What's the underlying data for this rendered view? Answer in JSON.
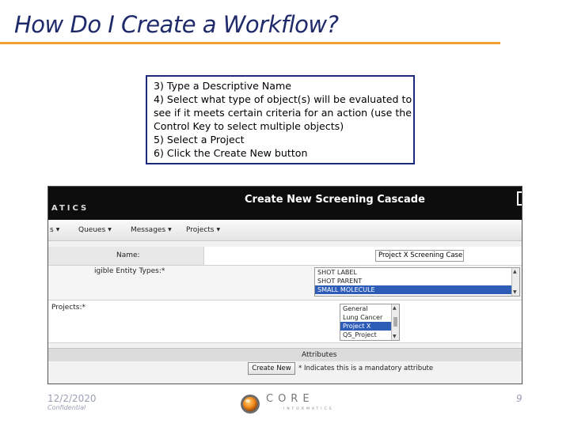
{
  "slide": {
    "title": "How Do I Create a Workflow?",
    "instructions": [
      "3) Type a Descriptive Name",
      "4) Select what type of object(s) will be evaluated to",
      "see if it meets certain criteria for an action (use the",
      "Control Key to select multiple objects)",
      "5) Select a Project",
      "6) Click the Create New button"
    ],
    "footer": {
      "date": "12/2/2020",
      "confidential": "Confidential",
      "page": "9"
    },
    "logo": {
      "word": "CORE",
      "sub": "INFORMATICS"
    }
  },
  "app": {
    "brand": "ATICS",
    "page_heading": "Create New Screening Cascade",
    "nav": [
      "s",
      "Queues",
      "Messages",
      "Projects"
    ],
    "form": {
      "name_label": "Name:",
      "name_value": "Project X Screening Case",
      "types_label": "igible Entity Types:*",
      "entity_types": [
        "SHOT LABEL",
        "SHOT PARENT",
        "SMALL MOLECULE"
      ],
      "entity_selected": "SMALL MOLECULE",
      "projects_label": "Projects:*",
      "projects": [
        "General",
        "Lung Cancer",
        "Project X",
        "QS_Project"
      ],
      "project_selected": "Project X"
    },
    "attributes_label": "Attributes",
    "create_button": "Create New",
    "mandatory_note": "* Indicates this is a mandatory attribute"
  },
  "colors": {
    "title": "#1f2a6b",
    "rule": "#f0a030",
    "note_border": "#1b2a7c",
    "selection": "#2e5db8"
  }
}
